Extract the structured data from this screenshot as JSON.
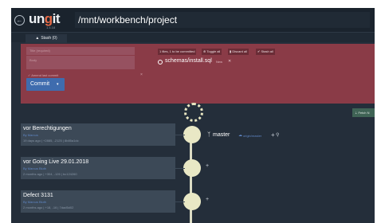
{
  "header": {
    "back_icon": "circle-arrow-left-icon",
    "logo_prefix": "un",
    "logo_accent": "g",
    "logo_suffix": "it",
    "version": "1.4.18",
    "path": "/mnt/workbench/project"
  },
  "subbar": {
    "stash_label": "Stash (0)",
    "stash_icon": "archive-icon"
  },
  "staging": {
    "title_placeholder": "Title (required)",
    "body_placeholder": "Body",
    "amend_label": "✓ Amend last commit",
    "amend_mark": "×",
    "commit_label": "Commit",
    "commit_caret": "▾",
    "toolbar": [
      "1 files, 1 to be committed",
      "⊕ Toggle all",
      "▮ Discard all",
      "✔ Stash all"
    ],
    "file": {
      "name": "schemas/install.sql",
      "status": "New",
      "discard": "✕",
      "icon": "checkbox-circle-icon"
    }
  },
  "fetch_label": "⇣ Fetch N",
  "branch": {
    "icon": "branch-icon",
    "name": "master",
    "remote_icon": "cloud-branch-icon",
    "remote": "origin/master",
    "add": "+",
    "search": "🔍"
  },
  "commits": [
    {
      "title": "vor Berechtigungen",
      "author": "By Marcus",
      "meta": "19 days ago | +2885, -2125 | 8b85a1dc"
    },
    {
      "title": "vor Going Live 29.01.2018",
      "author": "By Marcus Bluth",
      "meta": "2 months ago | +304, -126 | bc124260"
    },
    {
      "title": "Defect 3131",
      "author": "By Marcus Bluth",
      "meta": "2 months ago | +18, -16 | 7dad5d02"
    }
  ],
  "colors": {
    "background": "#242e3a",
    "header": "#1a232d",
    "staging": "#8a3b47",
    "commit_button": "#3f6cae",
    "node": "#e9e8c5",
    "card": "#3c4957",
    "author": "#5f86c4"
  }
}
